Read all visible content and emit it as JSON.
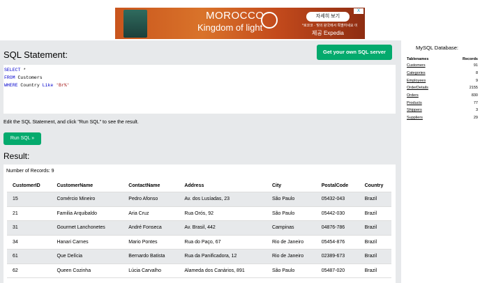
{
  "ad": {
    "title": "MOROCCO",
    "subtitle": "Kingdom of light",
    "button": "자세히 보기",
    "small_text": "*로코코 · 빛의 왕국에서 특별하세요 이",
    "brand": "Expedia",
    "brand_prefix": "제공",
    "close": "X"
  },
  "editor": {
    "heading": "SQL Statement:",
    "get_server": "Get your own SQL server",
    "lines": {
      "l1_kw": "SELECT",
      "l1_rest": " *",
      "l2_kw": "FROM",
      "l2_rest": " Customers",
      "l3_kw": "WHERE",
      "l3_mid": " Country ",
      "l3_kw2": "Like",
      "l3_sp": " ",
      "l3_str": "'Br%'"
    },
    "instruction": "Edit the SQL Statement, and click \"Run SQL\" to see the result.",
    "run_button": "Run SQL »"
  },
  "result": {
    "heading": "Result:",
    "count_label": "Number of Records: 9",
    "columns": [
      "CustomerID",
      "CustomerName",
      "ContactName",
      "Address",
      "City",
      "PostalCode",
      "Country"
    ],
    "rows": [
      [
        "15",
        "Comércio Mineiro",
        "Pedro Afonso",
        "Av. dos Lusíadas, 23",
        "São Paulo",
        "05432-043",
        "Brazil"
      ],
      [
        "21",
        "Familia Arquibaldo",
        "Aria Cruz",
        "Rua Orós, 92",
        "São Paulo",
        "05442-030",
        "Brazil"
      ],
      [
        "31",
        "Gourmet Lanchonetes",
        "André Fonseca",
        "Av. Brasil, 442",
        "Campinas",
        "04876-786",
        "Brazil"
      ],
      [
        "34",
        "Hanari Carnes",
        "Mario Pontes",
        "Rua do Paço, 67",
        "Rio de Janeiro",
        "05454-876",
        "Brazil"
      ],
      [
        "61",
        "Que Delícia",
        "Bernardo Batista",
        "Rua da Panificadora, 12",
        "Rio de Janeiro",
        "02389-673",
        "Brazil"
      ],
      [
        "62",
        "Queen Cozinha",
        "Lúcia Carvalho",
        "Alameda dos Canàrios, 891",
        "São Paulo",
        "05487-020",
        "Brazil"
      ]
    ]
  },
  "database": {
    "title": "MySQL Database:",
    "headers": [
      "Tablenames",
      "Records"
    ],
    "tables": [
      [
        "Customers",
        "91"
      ],
      [
        "Categories",
        "8"
      ],
      [
        "Employees",
        "9"
      ],
      [
        "OrderDetails",
        "2155"
      ],
      [
        "Orders",
        "830"
      ],
      [
        "Products",
        "77"
      ],
      [
        "Shippers",
        "3"
      ],
      [
        "Suppliers",
        "29"
      ]
    ]
  },
  "colors": {
    "green": "#04aa6d",
    "panel": "#e7e9eb",
    "keyword": "#0000cc",
    "string": "#a31515"
  }
}
